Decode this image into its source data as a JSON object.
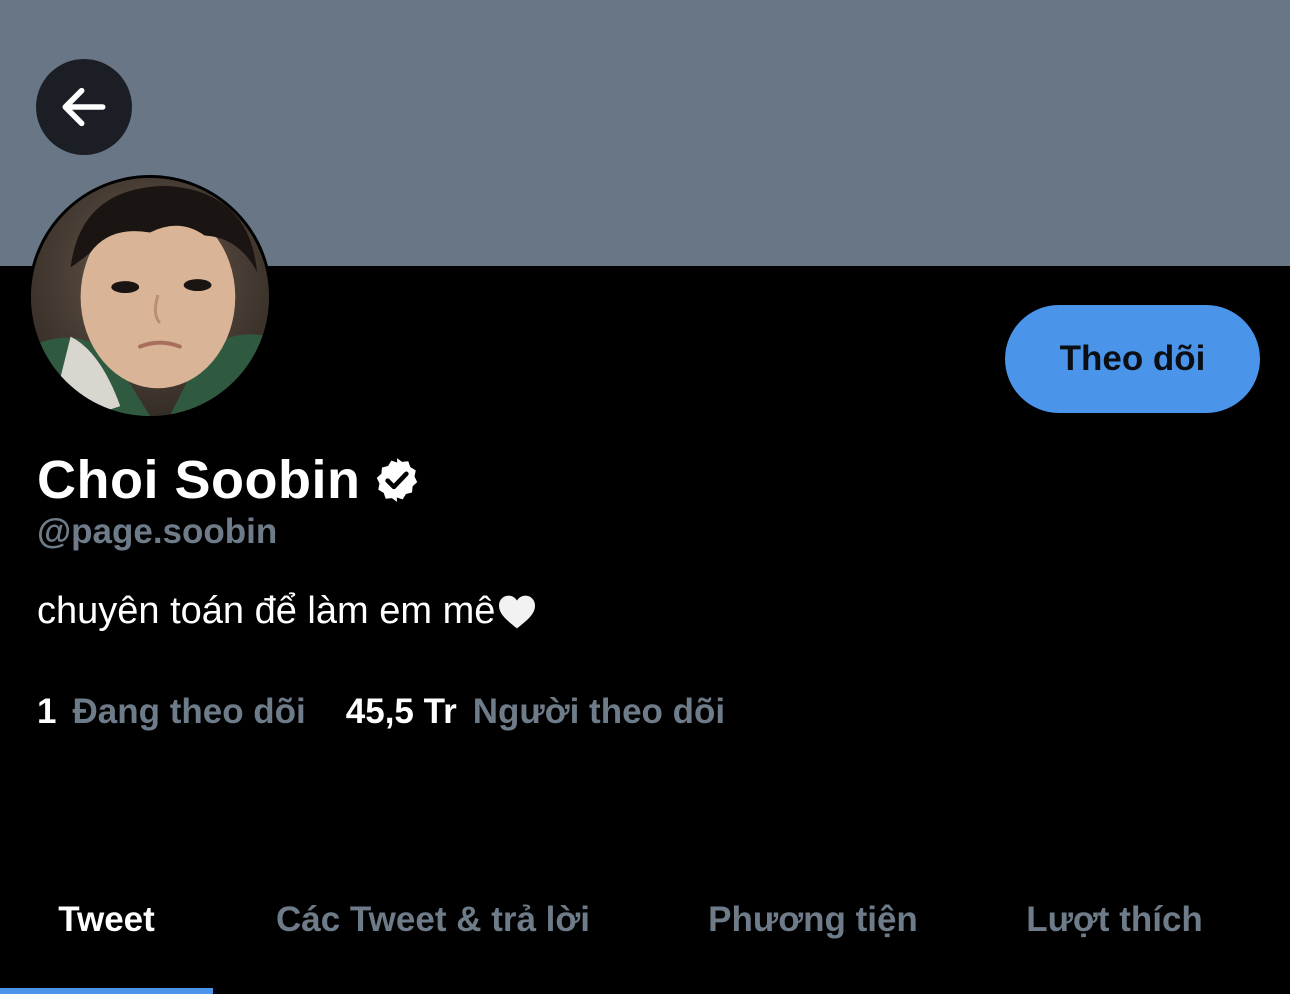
{
  "header": {
    "back_icon": "arrow-left-icon",
    "banner_color": "#687686"
  },
  "profile": {
    "display_name": "Choi Soobin",
    "verified_icon": "verified-badge-icon",
    "handle": "@page.soobin",
    "bio": "chuyên toán để làm em mê",
    "bio_emoji": "white-heart-icon",
    "avatar": "profile-photo"
  },
  "actions": {
    "follow_label": "Theo dõi",
    "follow_color": "#4a94ea"
  },
  "stats": {
    "following_count": "1",
    "following_label": "Đang theo dõi",
    "followers_count": "45,5 Tr",
    "followers_label": "Người theo dõi"
  },
  "tabs": [
    {
      "label": "Tweet",
      "active": true
    },
    {
      "label": "Các Tweet & trả lời",
      "active": false
    },
    {
      "label": "Phương tiện",
      "active": false
    },
    {
      "label": "Lượt thích",
      "active": false
    }
  ],
  "colors": {
    "background": "#000000",
    "muted_text": "#6e7b88",
    "accent": "#4a94ea"
  }
}
